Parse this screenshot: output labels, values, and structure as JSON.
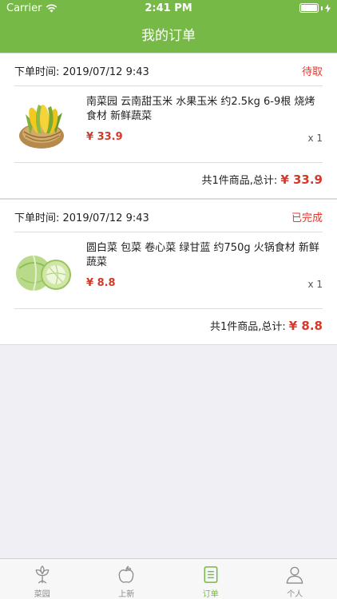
{
  "status_bar": {
    "carrier": "Carrier",
    "time": "2:41 PM"
  },
  "nav": {
    "title": "我的订单"
  },
  "orders": [
    {
      "time_label": "下单时间: 2019/07/12  9:43",
      "status": "待取",
      "product": {
        "name": "南菜园 云南甜玉米 水果玉米 约2.5kg 6-9根 烧烤食材 新鲜蔬菜",
        "price": "¥ 33.9",
        "qty": "x 1",
        "image_icon": "corn-image"
      },
      "summary_label": "共1件商品,总计:",
      "total": "¥ 33.9"
    },
    {
      "time_label": "下单时间: 2019/07/12  9:43",
      "status": "已完成",
      "product": {
        "name": "圆白菜 包菜 卷心菜 绿甘蓝 约750g 火锅食材 新鲜蔬菜",
        "price": "¥ 8.8",
        "qty": "x 1",
        "image_icon": "cabbage-image"
      },
      "summary_label": "共1件商品,总计:",
      "total": "¥ 8.8"
    }
  ],
  "tabbar": {
    "items": [
      {
        "label": "菜园",
        "icon": "plant-icon",
        "active": false
      },
      {
        "label": "上新",
        "icon": "apple-icon",
        "active": false
      },
      {
        "label": "订单",
        "icon": "order-list-icon",
        "active": true
      },
      {
        "label": "个人",
        "icon": "person-icon",
        "active": false
      }
    ]
  },
  "colors": {
    "brand_green": "#76b947",
    "price_red": "#d33a2c",
    "status_red": "#e0392f"
  }
}
